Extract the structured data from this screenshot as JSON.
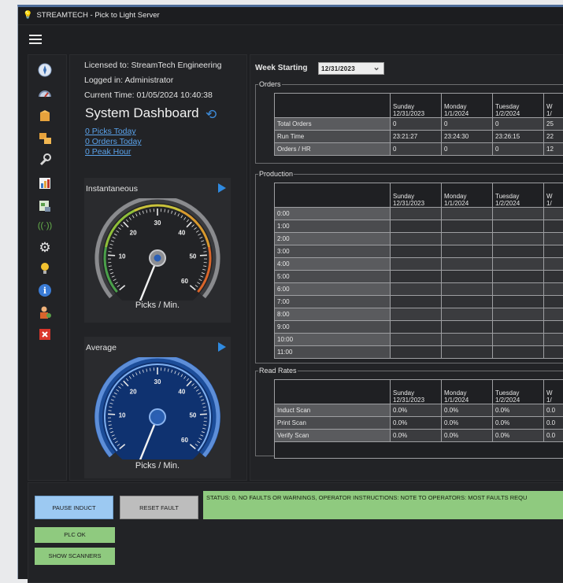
{
  "window": {
    "title": "STREAMTECH - Pick to Light Server"
  },
  "sidebar": {
    "icons": [
      "compass-icon",
      "speedometer-icon",
      "box-icon",
      "boxes-icon",
      "wrench-icon",
      "bar-chart-icon",
      "report-icon",
      "signal-icon",
      "gear-icon",
      "lightbulb-icon",
      "info-icon",
      "person-icon",
      "close-icon"
    ]
  },
  "info": {
    "licensed": "Licensed to: StreamTech Engineering",
    "logged": "Logged in: Administrator",
    "time": "Current Time: 01/05/2024 10:40:38",
    "title": "System Dashboard",
    "links": [
      "0 Picks Today",
      "0 Orders Today",
      "0 Peak Hour"
    ]
  },
  "gauges": [
    {
      "title": "Instantaneous",
      "caption": "Picks / Min.",
      "value": 0,
      "ticks": [
        "10",
        "20",
        "30",
        "40",
        "50",
        "60"
      ]
    },
    {
      "title": "Average",
      "caption": "Picks / Min.",
      "value": 0,
      "ticks": [
        "10",
        "20",
        "30",
        "40",
        "50",
        "60"
      ]
    }
  ],
  "week": {
    "label": "Week Starting",
    "value": "12/31/2023"
  },
  "days": [
    [
      "Sunday",
      "12/31/2023"
    ],
    [
      "Monday",
      "1/1/2024"
    ],
    [
      "Tuesday",
      "1/2/2024"
    ],
    [
      "W",
      "1/"
    ]
  ],
  "orders": {
    "legend": "Orders",
    "rows": [
      [
        "Total Orders",
        "0",
        "0",
        "0",
        "25"
      ],
      [
        "Run Time",
        "23:21:27",
        "23:24:30",
        "23:26:15",
        "22"
      ],
      [
        "Orders / HR",
        "0",
        "0",
        "0",
        "12"
      ]
    ]
  },
  "production": {
    "legend": "Production",
    "rows": [
      "0:00",
      "1:00",
      "2:00",
      "3:00",
      "4:00",
      "5:00",
      "6:00",
      "7:00",
      "8:00",
      "9:00",
      "10:00",
      "11:00"
    ]
  },
  "read_rates": {
    "legend": "Read Rates",
    "rows": [
      [
        "Induct Scan",
        "0.0%",
        "0.0%",
        "0.0%",
        "0.0"
      ],
      [
        "Print Scan",
        "0.0%",
        "0.0%",
        "0.0%",
        "0.0"
      ],
      [
        "Verify Scan",
        "0.0%",
        "0.0%",
        "0.0%",
        "0.0"
      ]
    ]
  },
  "bottom": {
    "pause": "PAUSE INDUCT",
    "reset": "RESET FAULT",
    "plc": "PLC OK",
    "scanners": "SHOW SCANNERS",
    "status": "STATUS: 0, NO FAULTS OR WARNINGS, OPERATOR INSTRUCTIONS: NOTE TO OPERATORS: MOST FAULTS REQU"
  },
  "colors": {
    "accent": "#2f8ae0",
    "status_green": "#8fca7f",
    "pause_blue": "#9cc9f2",
    "reset_gray": "#bdbdbd"
  }
}
